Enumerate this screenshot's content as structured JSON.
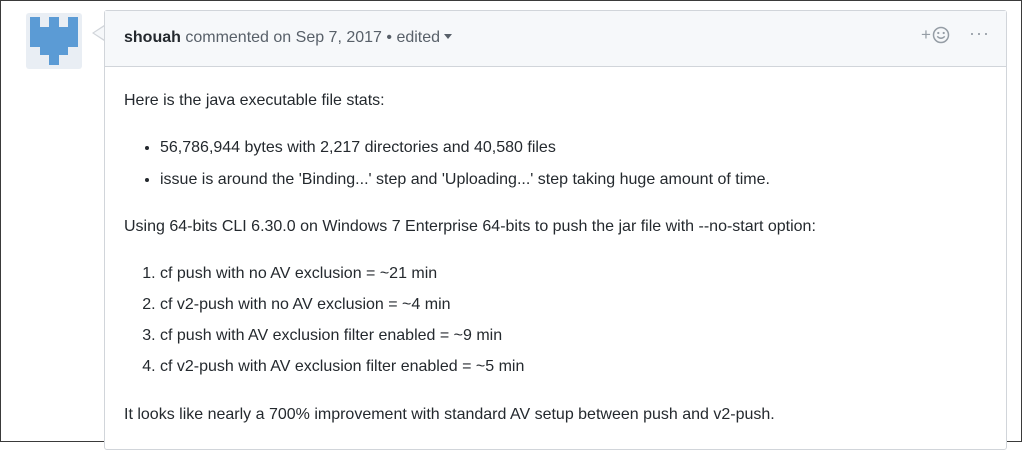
{
  "comment": {
    "author": "shouah",
    "action": "commented on",
    "date": "Sep 7, 2017",
    "separator": "•",
    "edited_label": "edited",
    "reaction_plus": "+",
    "more_label": "···"
  },
  "body": {
    "intro": "Here is the java executable file stats:",
    "bullets": [
      "56,786,944 bytes with 2,217 directories and 40,580 files",
      "issue is around the 'Binding...' step and 'Uploading...' step taking huge amount of time."
    ],
    "setup": "Using 64-bits CLI 6.30.0 on Windows 7 Enterprise 64-bits to push the jar file with --no-start option:",
    "results": [
      "cf push with no AV exclusion = ~21 min",
      "cf v2-push with no AV exclusion = ~4 min",
      "cf push with AV exclusion filter enabled = ~9 min",
      "cf v2-push with AV exclusion filter enabled = ~5 min"
    ],
    "conclusion": "It looks like nearly a 700% improvement with standard AV setup between push and v2-push."
  },
  "icons": {
    "avatar": "identicon-avatar",
    "reaction": "smiley-icon",
    "more": "kebab-horizontal-icon",
    "dropdown": "chevron-down-icon"
  },
  "colors": {
    "avatar_blue": "#5b9bd5",
    "header_bg": "#f6f8fa",
    "border": "#d1d5da"
  }
}
